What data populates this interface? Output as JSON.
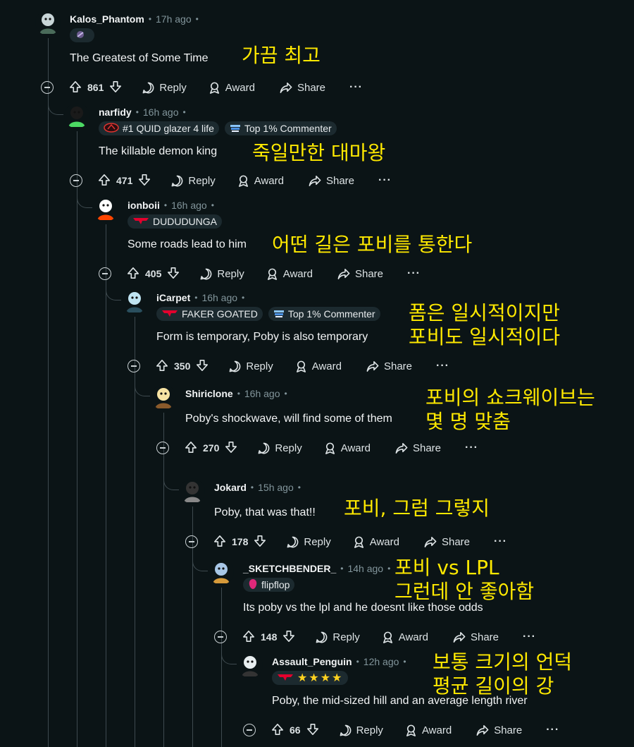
{
  "comments": [
    {
      "username": "Kalos_Phantom",
      "time": "17h ago",
      "flairs": [
        {
          "icon": "mini-avatar-icon",
          "text": ""
        }
      ],
      "body": "The Greatest of Some Time",
      "votes": "861",
      "translation": [
        "가끔 최고"
      ]
    },
    {
      "username": "narfidy",
      "time": "16h ago",
      "flairs": [
        {
          "icon": "team-logo-icon",
          "text": "#1 QUID glazer 4 life"
        },
        {
          "icon": "top-commenter-icon",
          "text": "Top 1% Commenter"
        }
      ],
      "body": "The killable demon king",
      "votes": "471",
      "translation": [
        "죽일만한 대마왕"
      ]
    },
    {
      "username": "ionboii",
      "time": "16h ago",
      "flairs": [
        {
          "icon": "t1-logo-icon",
          "text": "DUDUDUNGA"
        }
      ],
      "body": "Some roads lead to him",
      "votes": "405",
      "translation": [
        "어떤 길은 포비를 통한다"
      ]
    },
    {
      "username": "iCarpet",
      "time": "16h ago",
      "flairs": [
        {
          "icon": "t1-logo-icon",
          "text": "FAKER GOATED"
        },
        {
          "icon": "top-commenter-icon",
          "text": "Top 1% Commenter"
        }
      ],
      "body": "Form is temporary, Poby is also temporary",
      "votes": "350",
      "translation": [
        "폼은 일시적이지만",
        "포비도 일시적이다"
      ]
    },
    {
      "username": "Shiriclone",
      "time": "16h ago",
      "flairs": [],
      "body": "Poby's shockwave, will find some of them",
      "votes": "270",
      "translation": [
        "포비의 쇼크웨이브는",
        "몇 명 맞춤"
      ]
    },
    {
      "username": "Jokard",
      "time": "15h ago",
      "flairs": [],
      "body": "Poby, that was that!!",
      "votes": "178",
      "translation": [
        "포비, 그럼 그렇지"
      ]
    },
    {
      "username": "_SKETCHBENDER_",
      "time": "14h ago",
      "flairs": [
        {
          "icon": "flipflop-icon",
          "text": "flipflop"
        }
      ],
      "body": "Its poby vs the lpl and he doesnt like those odds",
      "votes": "148",
      "translation": [
        "포비 vs LPL",
        "그런데 안 좋아함"
      ]
    },
    {
      "username": "Assault_Penguin",
      "time": "12h ago",
      "flairs": [
        {
          "icon": "t1-stars-icon",
          "text": "★★★★"
        }
      ],
      "body": "Poby, the mid-sized hill and an average length river",
      "votes": "66",
      "translation": [
        "보통 크기의 언덕",
        "평균 길이의 강"
      ]
    }
  ],
  "actions": {
    "reply": "Reply",
    "award": "Award",
    "share": "Share",
    "more": "···"
  },
  "colors": {
    "background": "#0b1416",
    "translation": "#ffe900",
    "meta": "#82959b"
  }
}
